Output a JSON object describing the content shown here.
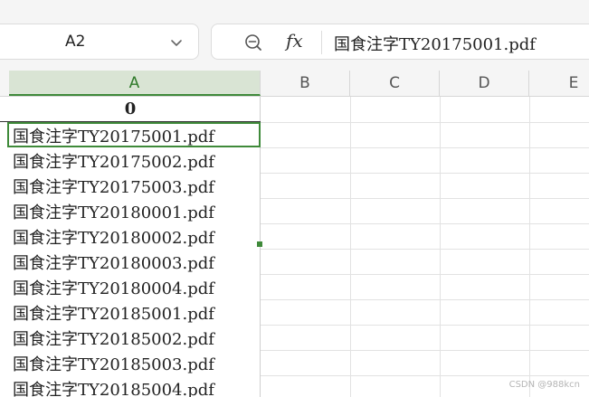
{
  "namebox": {
    "value": "A2"
  },
  "formula_bar": {
    "fx_label": "fx",
    "value": "国食注字TY20175001.pdf"
  },
  "columns": [
    "A",
    "B",
    "C",
    "D",
    "E"
  ],
  "selected_column": "A",
  "column_a": {
    "header": "0",
    "rows": [
      "国食注字TY20175001.pdf",
      "国食注字TY20175002.pdf",
      "国食注字TY20175003.pdf",
      "国食注字TY20180001.pdf",
      "国食注字TY20180002.pdf",
      "国食注字TY20180003.pdf",
      "国食注字TY20180004.pdf",
      "国食注字TY20185001.pdf",
      "国食注字TY20185002.pdf",
      "国食注字TY20185003.pdf",
      "国食注字TY20185004.pdf"
    ]
  },
  "active_row": 0,
  "watermark": "CSDN @988kcn",
  "colors": {
    "accent": "#3f8a3a",
    "selected_header_bg": "#d9e4d4",
    "toolbar_bg": "#f5f5f5"
  }
}
